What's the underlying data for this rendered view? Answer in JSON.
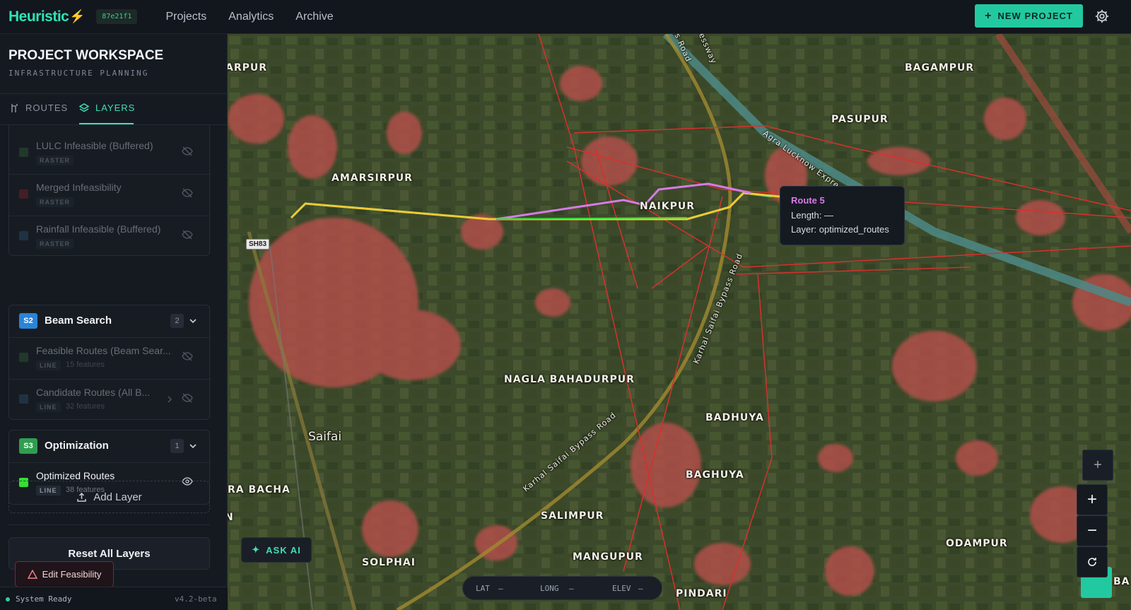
{
  "app": {
    "logo": "Heuristic",
    "build_hash": "87e21f1",
    "nav": [
      "Projects",
      "Analytics",
      "Archive"
    ],
    "new_project_label": "NEW PROJECT"
  },
  "sidebar": {
    "title": "PROJECT WORKSPACE",
    "subtitle": "INFRASTRUCTURE PLANNING",
    "tabs": [
      {
        "label": "ROUTES",
        "active": false
      },
      {
        "label": "LAYERS",
        "active": true
      }
    ],
    "group1_layers": [
      {
        "name": "LULC Infeasible (Buffered)",
        "type": "RASTER",
        "color": "#2e5a33",
        "visible": false
      },
      {
        "name": "Merged Infeasibility",
        "type": "RASTER",
        "color": "#7a2424",
        "visible": false
      },
      {
        "name": "Rainfall Infeasible (Buffered)",
        "type": "RASTER",
        "color": "#2a4d6e",
        "visible": false
      }
    ],
    "group_beam": {
      "badge": "S2",
      "badge_color": "#2a84d8",
      "title": "Beam Search",
      "count": "2",
      "layers": [
        {
          "name": "Feasible Routes (Beam Sear...",
          "type": "LINE",
          "count": "15 features",
          "color": "#2e5a33"
        },
        {
          "name": "Candidate Routes (All B...",
          "type": "LINE",
          "count": "32 features",
          "color": "#2a4d6e"
        }
      ]
    },
    "group_opt": {
      "badge": "S3",
      "badge_color": "#2f9e4f",
      "title": "Optimization",
      "count": "1",
      "layers": [
        {
          "name": "Optimized Routes",
          "type": "LINE",
          "count": "38 features",
          "color": "#33e033"
        }
      ]
    },
    "add_layer_label": "Add Layer",
    "reset_label": "Reset All Layers",
    "edit_feasibility_label": "Edit Feasibility",
    "status_text": "System Ready",
    "version": "v4.2-beta"
  },
  "map": {
    "places": [
      "ARPUR",
      "BAGAMPUR",
      "PASUPUR",
      "AMARSIRPUR",
      "NAIKPUR",
      "NAGLA BAHADURPUR",
      "BADHUYA",
      "Saifai",
      "BAGHUYA",
      "RA BACHA",
      "N",
      "SALIMPUR",
      "ODAMPUR",
      "SOLPHAI",
      "MANGUPUR",
      "PINDARI",
      "BA"
    ],
    "roads": [
      "SH83",
      "Agra Lucknow Express",
      "Karhal Saifai Bypass Road",
      "Karhal Saifai Bypass Road",
      "ss Road",
      "essway"
    ],
    "tooltip": {
      "title": "Route 5",
      "length": "Length: —",
      "layer": "Layer: optimized_routes"
    },
    "ask_ai_label": "ASK AI",
    "coords": {
      "lat": "LAT",
      "long": "LONG",
      "elev": "ELEV",
      "placeholder": "—"
    },
    "zoom": {
      "plus": "+",
      "minus": "−"
    }
  }
}
